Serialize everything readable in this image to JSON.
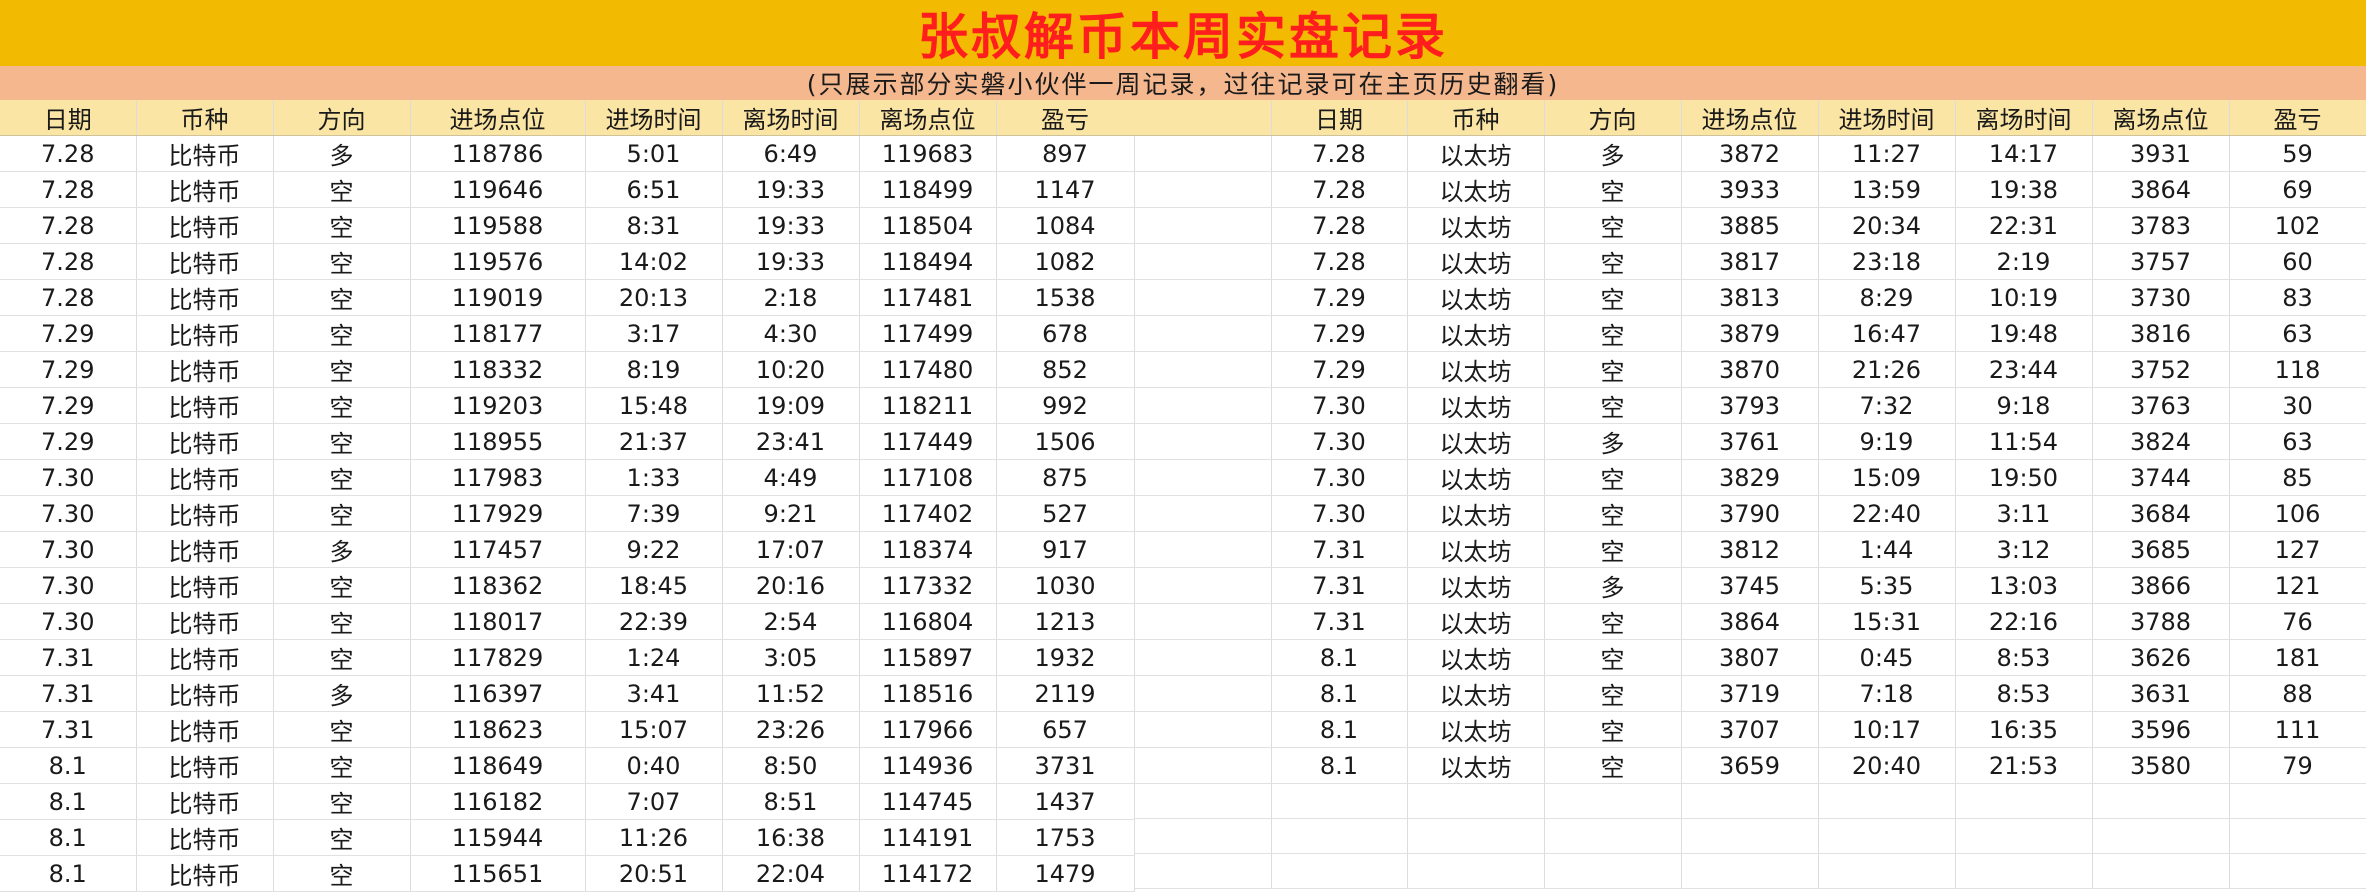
{
  "title": "张叔解币本周实盘记录",
  "subtitle": "(只展示部分实磐小伙伴一周记录，过往记录可在主页历史翻看)",
  "colors": {
    "title_bg": "#f2ba00",
    "title_text": "#ff1d1d",
    "subtitle_bg": "#f5b88e",
    "header_bg": "#fbe5a4",
    "long": "#1ea11e",
    "short": "#e51f1f",
    "pnl": "#e21b1b"
  },
  "headers": {
    "left": [
      "日期",
      "币种",
      "方向",
      "进场点位",
      "进场时间",
      "离场时间",
      "离场点位",
      "盈亏"
    ],
    "right": [
      "日期",
      "币种",
      "方向",
      "进场点位",
      "进场时间",
      "离场时间",
      "离场点位",
      "盈亏"
    ]
  },
  "btc_trades": [
    [
      "7.28",
      "比特币",
      "多",
      "118786",
      "5:01",
      "6:49",
      "119683",
      "897"
    ],
    [
      "7.28",
      "比特币",
      "空",
      "119646",
      "6:51",
      "19:33",
      "118499",
      "1147"
    ],
    [
      "7.28",
      "比特币",
      "空",
      "119588",
      "8:31",
      "19:33",
      "118504",
      "1084"
    ],
    [
      "7.28",
      "比特币",
      "空",
      "119576",
      "14:02",
      "19:33",
      "118494",
      "1082"
    ],
    [
      "7.28",
      "比特币",
      "空",
      "119019",
      "20:13",
      "2:18",
      "117481",
      "1538"
    ],
    [
      "7.29",
      "比特币",
      "空",
      "118177",
      "3:17",
      "4:30",
      "117499",
      "678"
    ],
    [
      "7.29",
      "比特币",
      "空",
      "118332",
      "8:19",
      "10:20",
      "117480",
      "852"
    ],
    [
      "7.29",
      "比特币",
      "空",
      "119203",
      "15:48",
      "19:09",
      "118211",
      "992"
    ],
    [
      "7.29",
      "比特币",
      "空",
      "118955",
      "21:37",
      "23:41",
      "117449",
      "1506"
    ],
    [
      "7.30",
      "比特币",
      "空",
      "117983",
      "1:33",
      "4:49",
      "117108",
      "875"
    ],
    [
      "7.30",
      "比特币",
      "空",
      "117929",
      "7:39",
      "9:21",
      "117402",
      "527"
    ],
    [
      "7.30",
      "比特币",
      "多",
      "117457",
      "9:22",
      "17:07",
      "118374",
      "917"
    ],
    [
      "7.30",
      "比特币",
      "空",
      "118362",
      "18:45",
      "20:16",
      "117332",
      "1030"
    ],
    [
      "7.30",
      "比特币",
      "空",
      "118017",
      "22:39",
      "2:54",
      "116804",
      "1213"
    ],
    [
      "7.31",
      "比特币",
      "空",
      "117829",
      "1:24",
      "3:05",
      "115897",
      "1932"
    ],
    [
      "7.31",
      "比特币",
      "多",
      "116397",
      "3:41",
      "11:52",
      "118516",
      "2119"
    ],
    [
      "7.31",
      "比特币",
      "空",
      "118623",
      "15:07",
      "23:26",
      "117966",
      "657"
    ],
    [
      "8.1",
      "比特币",
      "空",
      "118649",
      "0:40",
      "8:50",
      "114936",
      "3731"
    ],
    [
      "8.1",
      "比特币",
      "空",
      "116182",
      "7:07",
      "8:51",
      "114745",
      "1437"
    ],
    [
      "8.1",
      "比特币",
      "空",
      "115944",
      "11:26",
      "16:38",
      "114191",
      "1753"
    ],
    [
      "8.1",
      "比特币",
      "空",
      "115651",
      "20:51",
      "22:04",
      "114172",
      "1479"
    ]
  ],
  "eth_trades": [
    [
      "7.28",
      "以太坊",
      "多",
      "3872",
      "11:27",
      "14:17",
      "3931",
      "59"
    ],
    [
      "7.28",
      "以太坊",
      "空",
      "3933",
      "13:59",
      "19:38",
      "3864",
      "69"
    ],
    [
      "7.28",
      "以太坊",
      "空",
      "3885",
      "20:34",
      "22:31",
      "3783",
      "102"
    ],
    [
      "7.28",
      "以太坊",
      "空",
      "3817",
      "23:18",
      "2:19",
      "3757",
      "60"
    ],
    [
      "7.29",
      "以太坊",
      "空",
      "3813",
      "8:29",
      "10:19",
      "3730",
      "83"
    ],
    [
      "7.29",
      "以太坊",
      "空",
      "3879",
      "16:47",
      "19:48",
      "3816",
      "63"
    ],
    [
      "7.29",
      "以太坊",
      "空",
      "3870",
      "21:26",
      "23:44",
      "3752",
      "118"
    ],
    [
      "7.30",
      "以太坊",
      "空",
      "3793",
      "7:32",
      "9:18",
      "3763",
      "30"
    ],
    [
      "7.30",
      "以太坊",
      "多",
      "3761",
      "9:19",
      "11:54",
      "3824",
      "63"
    ],
    [
      "7.30",
      "以太坊",
      "空",
      "3829",
      "15:09",
      "19:50",
      "3744",
      "85"
    ],
    [
      "7.30",
      "以太坊",
      "空",
      "3790",
      "22:40",
      "3:11",
      "3684",
      "106"
    ],
    [
      "7.31",
      "以太坊",
      "空",
      "3812",
      "1:44",
      "3:12",
      "3685",
      "127"
    ],
    [
      "7.31",
      "以太坊",
      "多",
      "3745",
      "5:35",
      "13:03",
      "3866",
      "121"
    ],
    [
      "7.31",
      "以太坊",
      "空",
      "3864",
      "15:31",
      "22:16",
      "3788",
      "76"
    ],
    [
      "8.1",
      "以太坊",
      "空",
      "3807",
      "0:45",
      "8:53",
      "3626",
      "181"
    ],
    [
      "8.1",
      "以太坊",
      "空",
      "3719",
      "7:18",
      "8:53",
      "3631",
      "88"
    ],
    [
      "8.1",
      "以太坊",
      "空",
      "3707",
      "10:17",
      "16:35",
      "3596",
      "111"
    ],
    [
      "8.1",
      "以太坊",
      "空",
      "3659",
      "20:40",
      "21:53",
      "3580",
      "79"
    ]
  ]
}
